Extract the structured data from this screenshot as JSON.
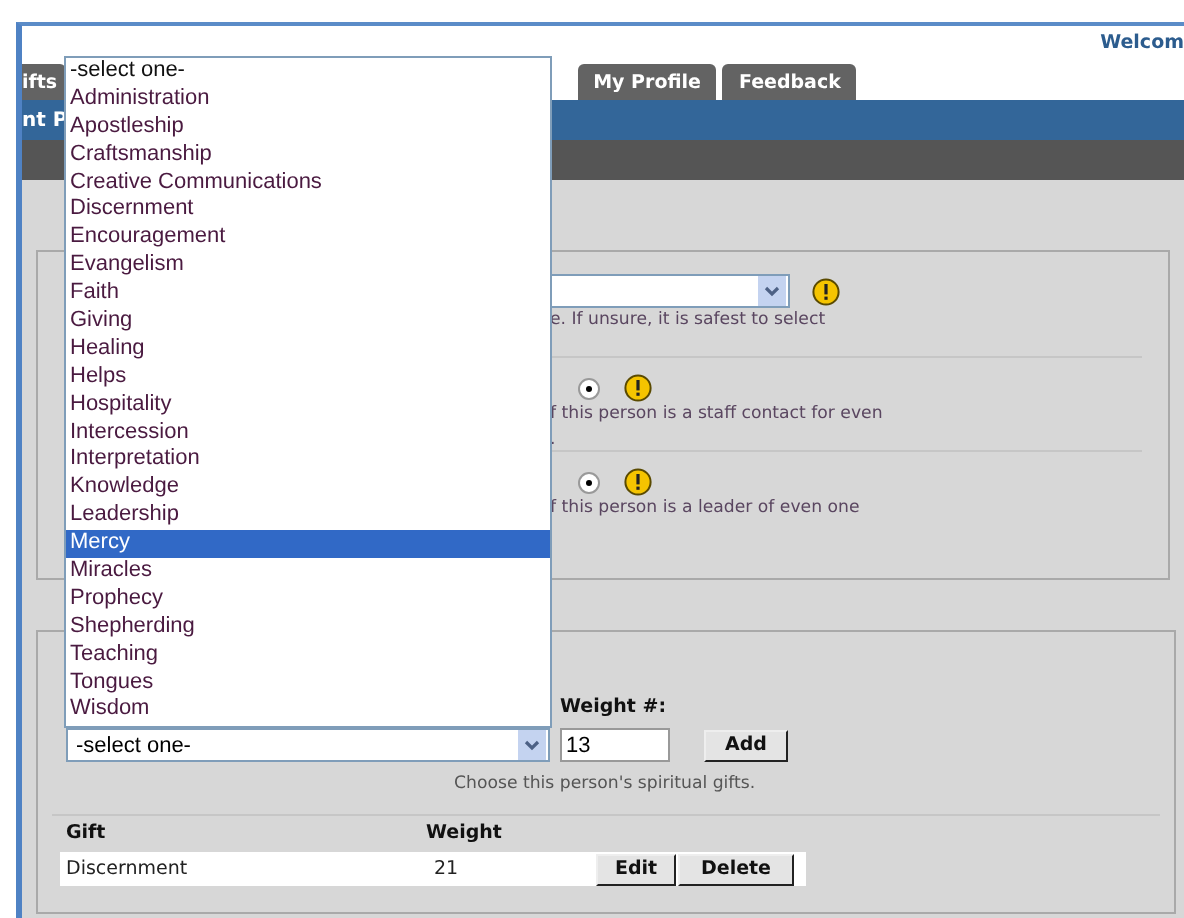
{
  "header": {
    "welcome": "Welcom"
  },
  "tabs": [
    {
      "label": "ifts",
      "selected": false
    },
    {
      "label": "My Profile",
      "selected": false
    },
    {
      "label": "Feedback",
      "selected": false
    }
  ],
  "title_bar": {
    "text": "nt P"
  },
  "role_section": {
    "select_hint": "e. If unsure, it is safest to select",
    "options": [
      {
        "selected": true,
        "hint": [
          "f this person is a staff contact for even",
          "."
        ]
      },
      {
        "selected": true,
        "hint": [
          "f this person is a leader of even one"
        ]
      }
    ]
  },
  "gifts_section": {
    "weight_label": "Weight #:",
    "select_value": "-select one-",
    "weight_value": "13",
    "add_button": "Add",
    "hint": "Choose this person's spiritual gifts.",
    "columns": [
      "Gift",
      "Weight"
    ],
    "rows": [
      {
        "gift": "Discernment",
        "weight": "21",
        "actions": [
          "Edit",
          "Delete"
        ]
      }
    ],
    "dropdown": [
      {
        "label": "-select one-",
        "selected": false
      },
      {
        "label": "Administration",
        "selected": false
      },
      {
        "label": "Apostleship",
        "selected": false
      },
      {
        "label": "Craftsmanship",
        "selected": false
      },
      {
        "label": "Creative Communications",
        "selected": false
      },
      {
        "label": "Discernment",
        "selected": false
      },
      {
        "label": "Encouragement",
        "selected": false
      },
      {
        "label": "Evangelism",
        "selected": false
      },
      {
        "label": "Faith",
        "selected": false
      },
      {
        "label": "Giving",
        "selected": false
      },
      {
        "label": "Healing",
        "selected": false
      },
      {
        "label": "Helps",
        "selected": false
      },
      {
        "label": "Hospitality",
        "selected": false
      },
      {
        "label": "Intercession",
        "selected": false
      },
      {
        "label": "Interpretation",
        "selected": false
      },
      {
        "label": "Knowledge",
        "selected": false
      },
      {
        "label": "Leadership",
        "selected": false
      },
      {
        "label": "Mercy",
        "selected": true
      },
      {
        "label": "Miracles",
        "selected": false
      },
      {
        "label": "Prophecy",
        "selected": false
      },
      {
        "label": "Shepherding",
        "selected": false
      },
      {
        "label": "Teaching",
        "selected": false
      },
      {
        "label": "Tongues",
        "selected": false
      },
      {
        "label": "Wisdom",
        "selected": false
      }
    ]
  }
}
